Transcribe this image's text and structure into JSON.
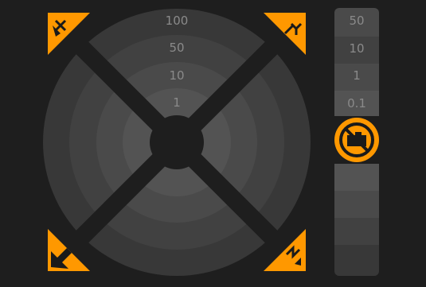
{
  "jog": {
    "xy_steps": [
      "1",
      "10",
      "50",
      "100"
    ],
    "corners": [
      {
        "name": "home-x-button",
        "icon": "home-x-icon"
      },
      {
        "name": "home-y-button",
        "icon": "home-y-icon"
      },
      {
        "name": "home-all-button",
        "icon": "home-all-icon"
      },
      {
        "name": "home-z-button",
        "icon": "home-z-icon"
      }
    ]
  },
  "zjog": {
    "up_steps": [
      "50",
      "10",
      "1",
      "0.1"
    ],
    "center_icon": "motors-off-icon"
  },
  "colors": {
    "background": "#1e1e1e",
    "ring_0": "#5b5b5b",
    "ring_1": "#535353",
    "ring_2": "#4a4a4a",
    "ring_3": "#414141",
    "ring_4": "#383838",
    "accent": "#ff9800",
    "icon_dark": "#1a1a1a",
    "label": "#8a8a8a"
  }
}
